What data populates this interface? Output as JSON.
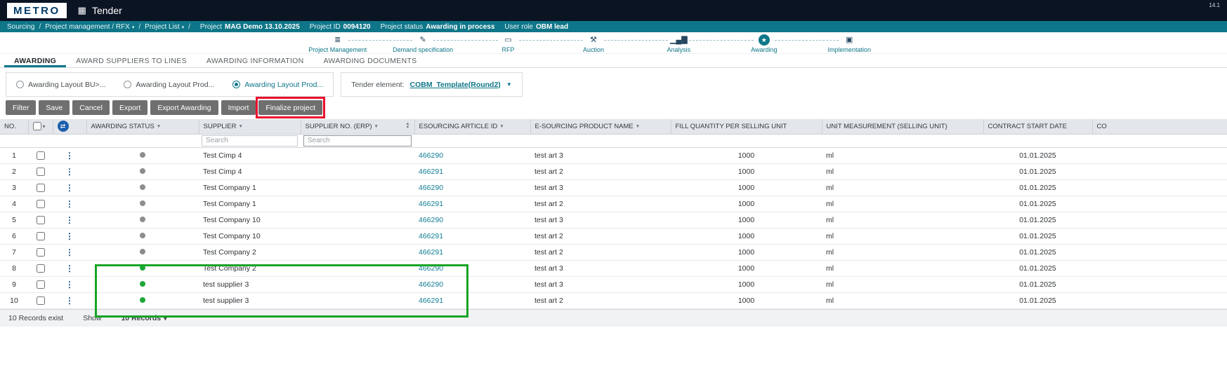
{
  "colors": {
    "topbar_bg": "#0b1423",
    "teal_accent": "#0e7688",
    "link": "#0f7e96",
    "status_green": "#1ca83a",
    "status_gray": "#8c8c8c",
    "annotation_red": "#e8112d",
    "annotation_green": "#17a426",
    "button_gray": "#6f6f6f"
  },
  "topbar": {
    "logo": "METRO",
    "app_title": "Tender",
    "version": "14.1"
  },
  "breadcrumb": {
    "path": [
      {
        "label": "Sourcing",
        "dropdown": false
      },
      {
        "label": "Project management / RFX",
        "dropdown": true
      },
      {
        "label": "Project List",
        "dropdown": true
      }
    ],
    "meta": [
      {
        "label": "Project",
        "value": "MAG Demo 13.10.2025"
      },
      {
        "label": "Project ID",
        "value": "0094120"
      },
      {
        "label": "Project status",
        "value": "Awarding in process"
      },
      {
        "label": "User role",
        "value": "OBM lead"
      }
    ]
  },
  "stepper": {
    "steps": [
      {
        "label": "Project Management",
        "icon": "list-icon",
        "glyph": "≣",
        "active": false
      },
      {
        "label": "Demand specification",
        "icon": "pencil-icon",
        "glyph": "✎",
        "active": false
      },
      {
        "label": "RFP",
        "icon": "monitor-icon",
        "glyph": "▭",
        "active": false
      },
      {
        "label": "Auction",
        "icon": "gavel-icon",
        "glyph": "⚒",
        "active": false
      },
      {
        "label": "Analysis",
        "icon": "bar-chart-icon",
        "glyph": "▁▄▇",
        "active": false
      },
      {
        "label": "Awarding",
        "icon": "award-icon",
        "glyph": "★",
        "active": true
      },
      {
        "label": "Implementation",
        "icon": "package-icon",
        "glyph": "▣",
        "active": false
      }
    ]
  },
  "tabs": [
    {
      "label": "AWARDING",
      "active": true
    },
    {
      "label": "AWARD SUPPLIERS TO LINES",
      "active": false
    },
    {
      "label": "AWARDING INFORMATION",
      "active": false
    },
    {
      "label": "AWARDING DOCUMENTS",
      "active": false
    }
  ],
  "layout_options": {
    "radios": [
      {
        "label": "Awarding Layout BU>...",
        "selected": false
      },
      {
        "label": "Awarding Layout Prod...",
        "selected": false
      },
      {
        "label": "Awarding Layout Prod...",
        "selected": true
      }
    ],
    "tender_element_label": "Tender element:",
    "tender_element_value": "COBM_Template(Round2)"
  },
  "toolbar": {
    "buttons": [
      "Filter",
      "Save",
      "Cancel",
      "Export",
      "Export Awarding",
      "Import",
      "Finalize project"
    ]
  },
  "table": {
    "headers": [
      {
        "label": "NO."
      },
      {
        "label": ""
      },
      {
        "label": ""
      },
      {
        "label": "AWARDING STATUS"
      },
      {
        "label": "SUPPLIER"
      },
      {
        "label": "SUPPLIER NO. (ERP)"
      },
      {
        "label": "ESOURCING ARTICLE ID"
      },
      {
        "label": "E-SOURCING PRODUCT NAME"
      },
      {
        "label": "FILL QUANTITY PER SELLING UNIT"
      },
      {
        "label": "UNIT MEASUREMENT (SELLING UNIT)"
      },
      {
        "label": "CONTRACT START DATE"
      },
      {
        "label": "CO"
      }
    ],
    "search_placeholder": "Search",
    "rows": [
      {
        "no": 1,
        "status": "gray",
        "supplier": "Test Cimp 4",
        "article_id": "466290",
        "product": "test art 3",
        "quantity": "1000",
        "unit": "ml",
        "start_date": "01.01.2025"
      },
      {
        "no": 2,
        "status": "gray",
        "supplier": "Test Cimp 4",
        "article_id": "466291",
        "product": "test art 2",
        "quantity": "1000",
        "unit": "ml",
        "start_date": "01.01.2025"
      },
      {
        "no": 3,
        "status": "gray",
        "supplier": "Test Company 1",
        "article_id": "466290",
        "product": "test art 3",
        "quantity": "1000",
        "unit": "ml",
        "start_date": "01.01.2025"
      },
      {
        "no": 4,
        "status": "gray",
        "supplier": "Test Company 1",
        "article_id": "466291",
        "product": "test art 2",
        "quantity": "1000",
        "unit": "ml",
        "start_date": "01.01.2025"
      },
      {
        "no": 5,
        "status": "gray",
        "supplier": "Test Company 10",
        "article_id": "466290",
        "product": "test art 3",
        "quantity": "1000",
        "unit": "ml",
        "start_date": "01.01.2025"
      },
      {
        "no": 6,
        "status": "gray",
        "supplier": "Test Company 10",
        "article_id": "466291",
        "product": "test art 2",
        "quantity": "1000",
        "unit": "ml",
        "start_date": "01.01.2025"
      },
      {
        "no": 7,
        "status": "gray",
        "supplier": "Test Company 2",
        "article_id": "466291",
        "product": "test art 2",
        "quantity": "1000",
        "unit": "ml",
        "start_date": "01.01.2025"
      },
      {
        "no": 8,
        "status": "green",
        "supplier": "Test Company 2",
        "article_id": "466290",
        "product": "test art 3",
        "quantity": "1000",
        "unit": "ml",
        "start_date": "01.01.2025"
      },
      {
        "no": 9,
        "status": "green",
        "supplier": "test supplier 3",
        "article_id": "466290",
        "product": "test art 3",
        "quantity": "1000",
        "unit": "ml",
        "start_date": "01.01.2025"
      },
      {
        "no": 10,
        "status": "green",
        "supplier": "test supplier 3",
        "article_id": "466291",
        "product": "test art 2",
        "quantity": "1000",
        "unit": "ml",
        "start_date": "01.01.2025"
      }
    ]
  },
  "footer": {
    "records_exist": "10 Records exist",
    "show_label": "Show",
    "page_size": "10 Records"
  }
}
